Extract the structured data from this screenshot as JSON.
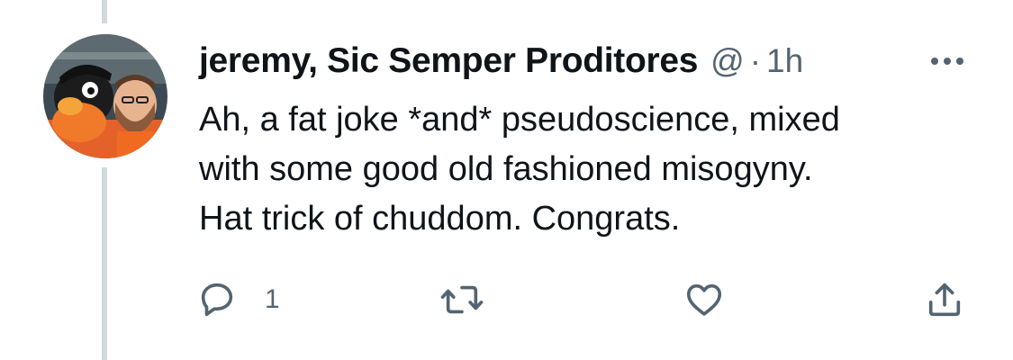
{
  "tweet": {
    "author_name": "jeremy, Sic Semper Proditores",
    "handle": "@",
    "separator": "·",
    "timestamp": "1h",
    "text": "Ah, a fat joke *and* pseudoscience,  mixed\nwith some good old fashioned misogyny.\nHat trick of chuddom. Congrats."
  },
  "actions": {
    "reply_count": "1",
    "icons": [
      "reply-icon",
      "retweet-icon",
      "like-icon",
      "share-icon"
    ]
  },
  "colors": {
    "text_primary": "#0f1419",
    "text_secondary": "#536471",
    "thread_line": "#cfd9de"
  }
}
